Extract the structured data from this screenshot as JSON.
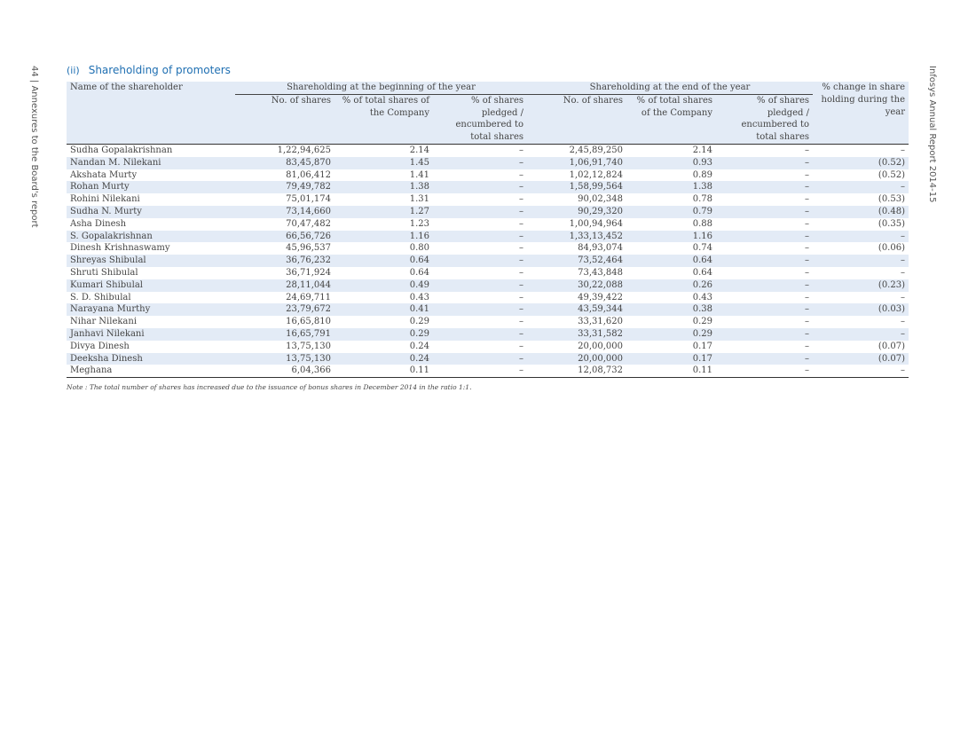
{
  "side_left": "44 | Annexures to the Board's report",
  "side_right": "Infosys Annual Report 2014-15",
  "section": {
    "number": "(ii)",
    "title": "Shareholding of promoters"
  },
  "headers": {
    "name": "Name of the shareholder",
    "beginning": "Shareholding at the beginning of the year",
    "end": "Shareholding at the end of the year",
    "change": "% change in share holding during the year",
    "b_shares": "No. of shares",
    "b_pct": "% of total shares of the Company",
    "b_pledged": "% of shares pledged / encumbered to total shares",
    "e_shares": "No. of shares",
    "e_pct": "% of total shares of the Company",
    "e_pledged": "% of shares pledged / encumbered to total shares"
  },
  "rows": [
    {
      "name": "Sudha Gopalakrishnan",
      "b_shares": "1,22,94,625",
      "b_pct": "2.14",
      "b_pledged": "–",
      "e_shares": "2,45,89,250",
      "e_pct": "2.14",
      "e_pledged": "–",
      "change": "–"
    },
    {
      "name": "Nandan M. Nilekani",
      "b_shares": "83,45,870",
      "b_pct": "1.45",
      "b_pledged": "–",
      "e_shares": "1,06,91,740",
      "e_pct": "0.93",
      "e_pledged": "–",
      "change": "(0.52)"
    },
    {
      "name": "Akshata Murty",
      "b_shares": "81,06,412",
      "b_pct": "1.41",
      "b_pledged": "–",
      "e_shares": "1,02,12,824",
      "e_pct": "0.89",
      "e_pledged": "–",
      "change": "(0.52)"
    },
    {
      "name": "Rohan Murty",
      "b_shares": "79,49,782",
      "b_pct": "1.38",
      "b_pledged": "–",
      "e_shares": "1,58,99,564",
      "e_pct": "1.38",
      "e_pledged": "–",
      "change": "–"
    },
    {
      "name": "Rohini Nilekani",
      "b_shares": "75,01,174",
      "b_pct": "1.31",
      "b_pledged": "–",
      "e_shares": "90,02,348",
      "e_pct": "0.78",
      "e_pledged": "–",
      "change": "(0.53)"
    },
    {
      "name": "Sudha N. Murty",
      "b_shares": "73,14,660",
      "b_pct": "1.27",
      "b_pledged": "–",
      "e_shares": "90,29,320",
      "e_pct": "0.79",
      "e_pledged": "–",
      "change": "(0.48)"
    },
    {
      "name": "Asha Dinesh",
      "b_shares": "70,47,482",
      "b_pct": "1.23",
      "b_pledged": "–",
      "e_shares": "1,00,94,964",
      "e_pct": "0.88",
      "e_pledged": "–",
      "change": "(0.35)"
    },
    {
      "name": "S. Gopalakrishnan",
      "b_shares": "66,56,726",
      "b_pct": "1.16",
      "b_pledged": "–",
      "e_shares": "1,33,13,452",
      "e_pct": "1.16",
      "e_pledged": "–",
      "change": "–"
    },
    {
      "name": "Dinesh Krishnaswamy",
      "b_shares": "45,96,537",
      "b_pct": "0.80",
      "b_pledged": "–",
      "e_shares": "84,93,074",
      "e_pct": "0.74",
      "e_pledged": "–",
      "change": "(0.06)"
    },
    {
      "name": "Shreyas Shibulal",
      "b_shares": "36,76,232",
      "b_pct": "0.64",
      "b_pledged": "–",
      "e_shares": "73,52,464",
      "e_pct": "0.64",
      "e_pledged": "–",
      "change": "–"
    },
    {
      "name": "Shruti Shibulal",
      "b_shares": "36,71,924",
      "b_pct": "0.64",
      "b_pledged": "–",
      "e_shares": "73,43,848",
      "e_pct": "0.64",
      "e_pledged": "–",
      "change": "–"
    },
    {
      "name": "Kumari Shibulal",
      "b_shares": "28,11,044",
      "b_pct": "0.49",
      "b_pledged": "–",
      "e_shares": "30,22,088",
      "e_pct": "0.26",
      "e_pledged": "–",
      "change": "(0.23)"
    },
    {
      "name": "S. D. Shibulal",
      "b_shares": "24,69,711",
      "b_pct": "0.43",
      "b_pledged": "–",
      "e_shares": "49,39,422",
      "e_pct": "0.43",
      "e_pledged": "–",
      "change": "–"
    },
    {
      "name": "Narayana Murthy",
      "b_shares": "23,79,672",
      "b_pct": "0.41",
      "b_pledged": "–",
      "e_shares": "43,59,344",
      "e_pct": "0.38",
      "e_pledged": "–",
      "change": "(0.03)"
    },
    {
      "name": "Nihar Nilekani",
      "b_shares": "16,65,810",
      "b_pct": "0.29",
      "b_pledged": "–",
      "e_shares": "33,31,620",
      "e_pct": "0.29",
      "e_pledged": "–",
      "change": "–"
    },
    {
      "name": "Janhavi Nilekani",
      "b_shares": "16,65,791",
      "b_pct": "0.29",
      "b_pledged": "–",
      "e_shares": "33,31,582",
      "e_pct": "0.29",
      "e_pledged": "–",
      "change": "–"
    },
    {
      "name": "Divya Dinesh",
      "b_shares": "13,75,130",
      "b_pct": "0.24",
      "b_pledged": "–",
      "e_shares": "20,00,000",
      "e_pct": "0.17",
      "e_pledged": "–",
      "change": "(0.07)"
    },
    {
      "name": "Deeksha Dinesh",
      "b_shares": "13,75,130",
      "b_pct": "0.24",
      "b_pledged": "–",
      "e_shares": "20,00,000",
      "e_pct": "0.17",
      "e_pledged": "–",
      "change": "(0.07)"
    },
    {
      "name": "Meghana",
      "b_shares": "6,04,366",
      "b_pct": "0.11",
      "b_pledged": "–",
      "e_shares": "12,08,732",
      "e_pct": "0.11",
      "e_pledged": "–",
      "change": "–"
    }
  ],
  "note": "Note : The total number of shares has increased due to the issuance of bonus shares in December 2014 in the ratio 1:1."
}
